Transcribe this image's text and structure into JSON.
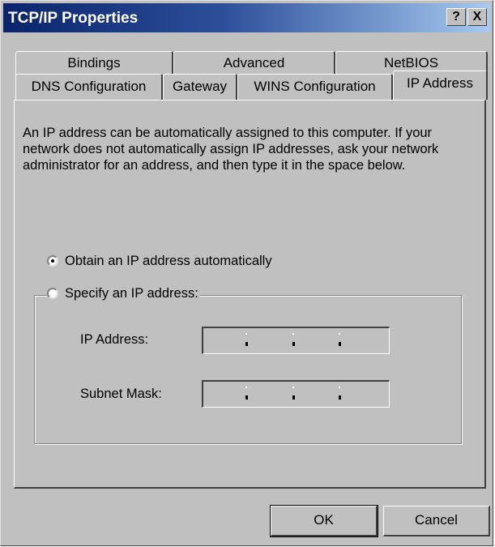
{
  "window": {
    "title": "TCP/IP Properties",
    "help_label": "?",
    "close_label": "X"
  },
  "tabs": {
    "back_row": [
      "Bindings",
      "Advanced",
      "NetBIOS"
    ],
    "front_row": [
      "DNS Configuration",
      "Gateway",
      "WINS Configuration",
      "IP Address"
    ],
    "active": "IP Address"
  },
  "panel": {
    "description": "An IP address can be automatically assigned to this computer. If your network does not automatically assign IP addresses, ask your network administrator for an address, and then type it in the space below.",
    "obtain_option": {
      "label": "Obtain an IP address automatically",
      "selected": true
    },
    "specify_option": {
      "label": "Specify an IP address:",
      "selected": false
    },
    "ip_address_label": "IP Address:",
    "ip_address_value": "",
    "subnet_mask_label": "Subnet Mask:",
    "subnet_mask_value": ""
  },
  "buttons": {
    "ok": "OK",
    "cancel": "Cancel"
  }
}
